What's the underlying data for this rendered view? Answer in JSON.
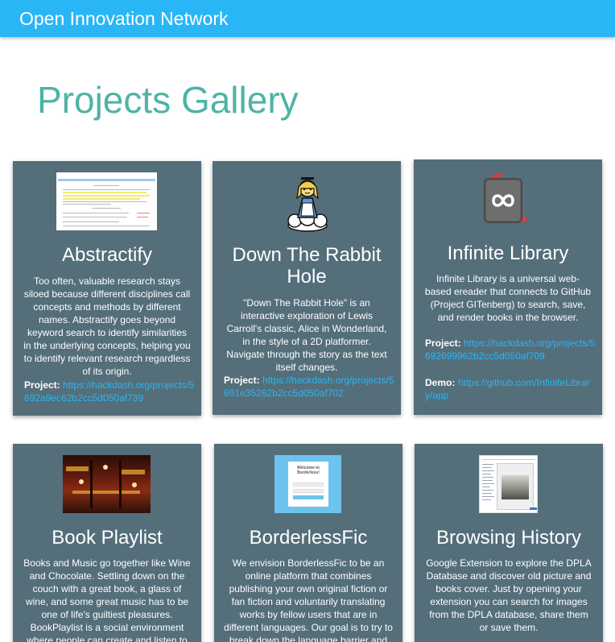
{
  "header": {
    "brand": "Open Innovation Network"
  },
  "page": {
    "title": "Projects Gallery"
  },
  "cards": [
    {
      "title": "Abstractify",
      "description": "Too often, valuable research stays siloed because different disciplines call concepts and methods by different names. Abstractify goes beyond keyword search to identify similarities in the underlying concepts, helping you to identify relevant research regardless of its origin.",
      "project_label": "Project:",
      "project_link": "https://hackdash.org/projects/5692a9ec62b2cc5d050af739",
      "icon": "document-screenshot"
    },
    {
      "title": "Down The Rabbit Hole",
      "description": "\"Down The Rabbit Hole\" is an interactive exploration of Lewis Carroll's classic, Alice in Wonderland, in the style of a 2D platformer. Navigate through the story as the text itself changes.",
      "project_label": "Project:",
      "project_link": "https://hackdash.org/projects/5691e35262b2cc5d050af702",
      "icon": "alice-on-cloud-icon"
    },
    {
      "title": "Infinite Library",
      "description": "Infinite Library is a universal web-based ereader that connects to GitHub (Project GITenberg) to search, save, and render books in the browser.",
      "project_label": "Project:",
      "project_link": "https://hackdash.org/projects/5692699962b2cc5d050af709",
      "demo_label": "Demo:",
      "demo_link": "https://github.com/InfiniteLibrary/app",
      "icon": "infinity-book-icon"
    },
    {
      "title": "Book Playlist",
      "description": "Books and Music go together like Wine and Chocolate. Settling down on the couch with a great book, a glass of wine, and some great music has to be one of life's guiltiest pleasures. BookPlaylist is a social environment where people can create and listen to collaborative music",
      "icon": "library-photo"
    },
    {
      "title": "BorderlessFic",
      "description": "We envision BorderlessFic to be an online platform that combines publishing your own original fiction or fan fiction and voluntarily translating works by fellow users that are in different languages. Our goal is to try to break down the language barrier and allow online writers to share",
      "icon": "welcome-screen",
      "thumb_text": "Welcome to Borderless!"
    },
    {
      "title": "Browsing History",
      "description": "Google Extension to explore the DPLA Database and discover old picture and books cover. Just by opening your extension you can search for images from the DPLA database, share them or save them.",
      "icon": "extension-screenshot"
    }
  ],
  "colors": {
    "header_bg": "#29b6f6",
    "title": "#4fb3a6",
    "card_bg": "#546e7a",
    "link": "#29b6f6"
  }
}
